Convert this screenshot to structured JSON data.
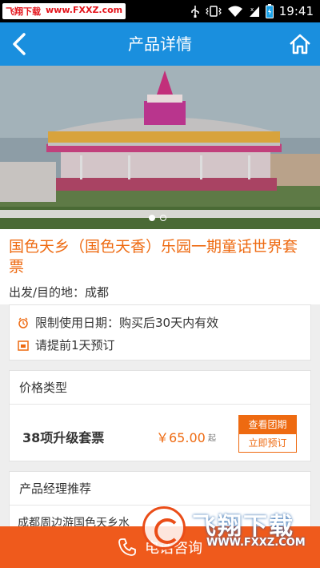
{
  "status_bar": {
    "watermark_name": "飞翔下载",
    "watermark_url": "www.FXXZ.com",
    "time": "19:41",
    "icons": [
      "usb-icon",
      "vibrate-icon",
      "wifi-icon",
      "signal-icon",
      "battery-icon"
    ]
  },
  "nav": {
    "title": "产品详情",
    "back_icon": "chevron-left-icon",
    "home_icon": "home-icon",
    "color": "#1a8fde"
  },
  "banner": {
    "image": "carousel-photo",
    "slide_count": 2,
    "active_slide": 1
  },
  "product": {
    "title": "国色天乡（国色天香）乐园一期童话世界套票",
    "destination": "出发/目的地：成都",
    "title_color": "#ee6a11"
  },
  "tips": [
    {
      "icon": "clock-icon",
      "text": "限制使用日期：购买后30天内有效"
    },
    {
      "icon": "calendar-icon",
      "text": "请提前1天预订"
    }
  ],
  "price": {
    "header": "价格类型",
    "package_name": "38项升级套票",
    "amount": "￥65.00",
    "suffix": "起",
    "buttons": {
      "tour": "查看团期",
      "book": "立即预订"
    }
  },
  "recommend": {
    "header": "产品经理推荐",
    "item": "成都周边游国色天乡水"
  },
  "call_bar": {
    "icon": "phone-icon",
    "label": "电话咨询",
    "color": "#ef5a1c"
  },
  "watermark": {
    "brand": "飞翔下载",
    "url": "WWW.FXXZ.COM"
  }
}
